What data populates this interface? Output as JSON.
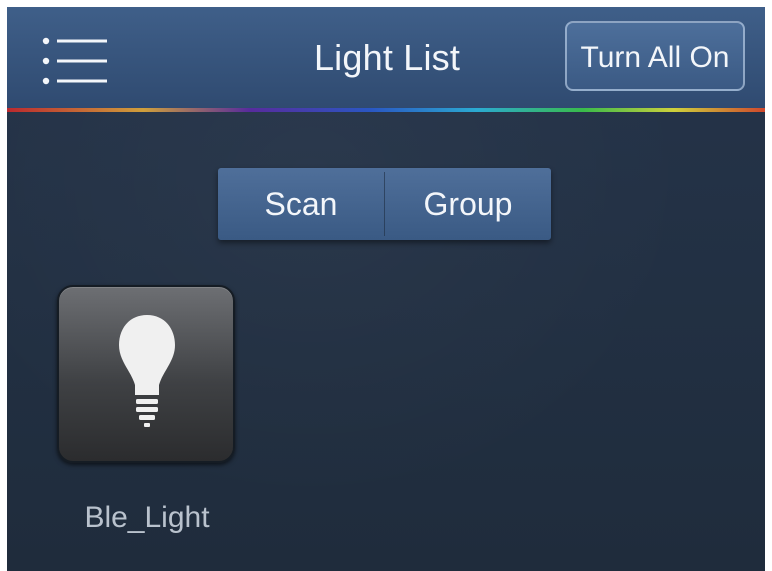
{
  "navbar": {
    "title": "Light List",
    "menu_icon": "hamburger-list-icon",
    "turn_all_on_label": "Turn All On"
  },
  "segmented_control": {
    "scan_label": "Scan",
    "group_label": "Group"
  },
  "devices": [
    {
      "name": "Ble_Light",
      "icon": "light-bulb-icon"
    }
  ],
  "colors": {
    "navbar": "#3a5880",
    "background": "#223040",
    "text": "#f3f6fa",
    "device_label": "#b9c2cd"
  }
}
